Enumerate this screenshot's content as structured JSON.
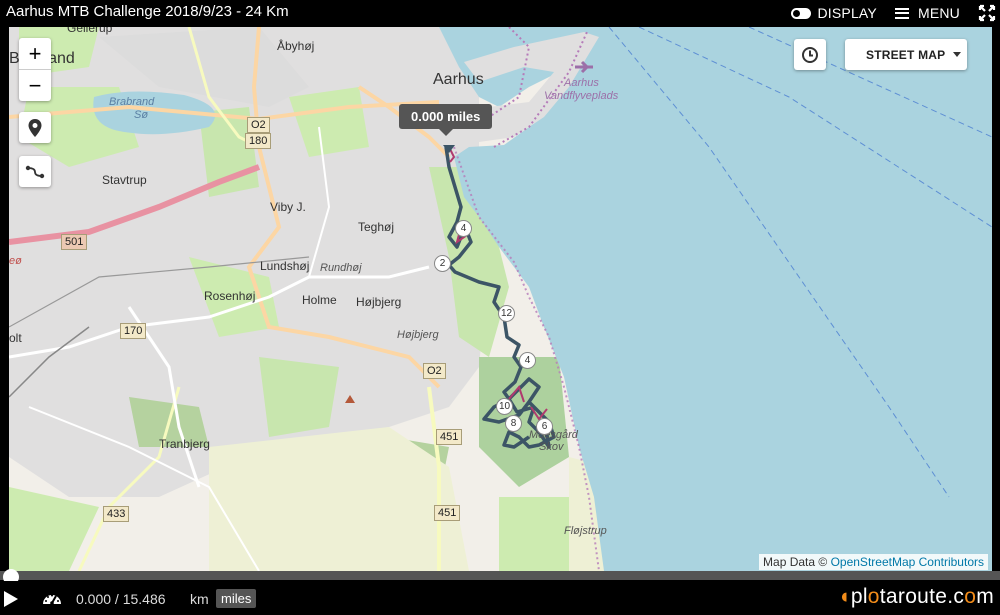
{
  "header": {
    "title": "Aarhus MTB Challenge 2018/9/23 - 24 Km",
    "display_label": "DISPLAY",
    "menu_label": "MENU"
  },
  "map": {
    "zoom_in_label": "+",
    "zoom_out_label": "−",
    "style_select_value": "STREET MAP",
    "tooltip": "0.000 miles",
    "attribution_prefix": "Map Data ©",
    "attribution_link": "OpenStreetMap Contributors",
    "places": {
      "aarhus": "Aarhus",
      "abyhoj": "Åbyhøj",
      "brabrand": "Brabrand",
      "brabrand_lake": "Brabrand",
      "brabrand_lake2": "Sø",
      "gellerup": "Gellerup",
      "stavtrup": "Stavtrup",
      "viby": "Viby J.",
      "teghoj": "Teghøj",
      "lundshoj": "Lundshøj",
      "rundhoj": "Rundhøj",
      "rosenhoj": "Rosenhøj",
      "holme": "Holme",
      "hojbjerg": "Højbjerg",
      "hojbjerg_it": "Højbjerg",
      "tranbjerg": "Tranbjerg",
      "airport1": "Aarhus",
      "airport2": "Vandflyveplads",
      "moesgard1": "Moesgård",
      "moesgard2": "Skov",
      "fljstrup": "Fløjstrup",
      "edge_o": "olt",
      "edge_eo": "eø"
    },
    "road_shields": {
      "o2a": "O2",
      "r180": "180",
      "r501": "501",
      "r170": "170",
      "o2b": "O2",
      "r451a": "451",
      "r451b": "451",
      "r433": "433"
    },
    "km_markers": [
      "4",
      "2",
      "12",
      "4",
      "10",
      "8",
      "6"
    ]
  },
  "player": {
    "distance": "0.000 / 15.486",
    "unit_km": "km",
    "unit_miles": "miles",
    "progress": 0
  },
  "brand": {
    "part1": "pl",
    "part2": "ta",
    "part3": "route",
    "part4": ".c",
    "part5": "m"
  },
  "colors": {
    "water": "#aad3df",
    "route": "#3c5566",
    "route_highlight": "#b03a6e",
    "brand_orange": "#f28c1a"
  }
}
